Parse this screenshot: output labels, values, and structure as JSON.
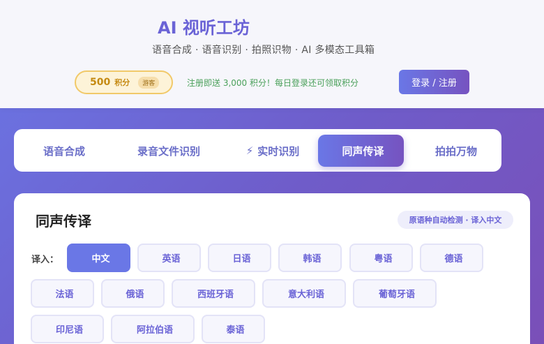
{
  "header": {
    "brand_icon": "",
    "brand_title": "AI 视听工坊",
    "subtitle": "语音合成 · 语音识别 · 拍照识物 · AI 多模态工具箱",
    "points": {
      "icon": "",
      "value": "500",
      "unit": "积分",
      "guest_tag": "游客"
    },
    "promo_icon": "",
    "promo_text": "注册即送 3,000 积分！每日登录还可领取积分",
    "login_label": "登录 / 注册"
  },
  "tabs": [
    {
      "icon": "",
      "label": "语音合成",
      "active": false
    },
    {
      "icon": "",
      "label": "录音文件识别",
      "active": false
    },
    {
      "icon": "⚡",
      "label": "实时识别",
      "active": false
    },
    {
      "icon": "",
      "label": "同声传译",
      "active": true
    },
    {
      "icon": "",
      "label": "拍拍万物",
      "active": false
    }
  ],
  "panel": {
    "title_icon": "",
    "title": "同声传译",
    "detect_tag": "原语种自动检测 · 译入中文",
    "target_label": "译入：",
    "languages": [
      {
        "flag": "",
        "label": "中文",
        "selected": true
      },
      {
        "flag": "",
        "label": "英语",
        "selected": false
      },
      {
        "flag": "",
        "label": "日语",
        "selected": false
      },
      {
        "flag": "",
        "label": "韩语",
        "selected": false
      },
      {
        "flag": "",
        "label": "粤语",
        "selected": false
      },
      {
        "flag": "",
        "label": "德语",
        "selected": false
      },
      {
        "flag": "",
        "label": "法语",
        "selected": false
      },
      {
        "flag": "",
        "label": "俄语",
        "selected": false
      },
      {
        "flag": "",
        "label": "西班牙语",
        "selected": false
      },
      {
        "flag": "",
        "label": "意大利语",
        "selected": false
      },
      {
        "flag": "",
        "label": "葡萄牙语",
        "selected": false
      },
      {
        "flag": "",
        "label": "印尼语",
        "selected": false
      },
      {
        "flag": "",
        "label": "阿拉伯语",
        "selected": false
      },
      {
        "flag": "",
        "label": "泰语",
        "selected": false
      }
    ]
  },
  "colors": {
    "accent": "#6a77e6",
    "accent_dark": "#7653c0",
    "promo_green": "#4aa05a",
    "points_gold": "#c58a12"
  }
}
